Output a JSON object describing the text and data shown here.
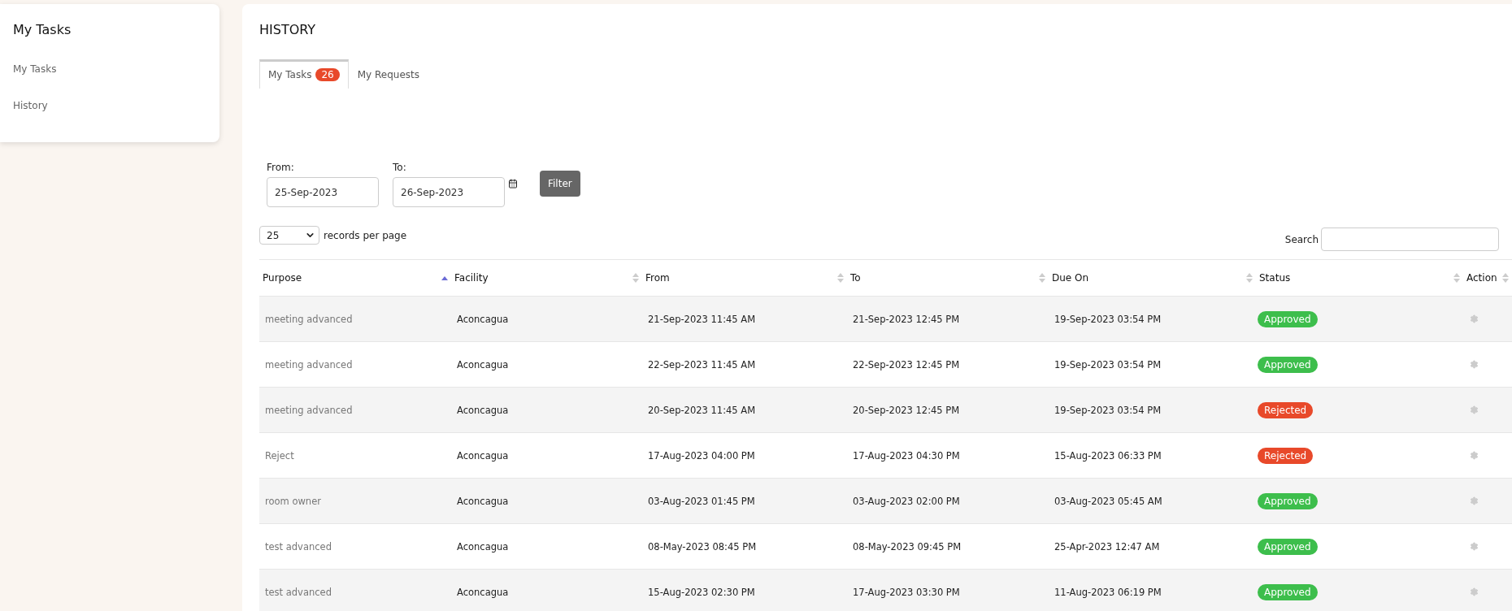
{
  "sidebar": {
    "title": "My Tasks",
    "items": [
      {
        "label": "My Tasks",
        "selected": false
      },
      {
        "label": "History",
        "selected": false
      }
    ]
  },
  "main": {
    "title": "HISTORY",
    "tabs": [
      {
        "label": "My Tasks",
        "badge": "26",
        "selected": true
      },
      {
        "label": "My Requests",
        "selected": false
      }
    ],
    "filter": {
      "from_label": "From:",
      "from_value": "25-Sep-2023",
      "to_label": "To:",
      "to_value": "26-Sep-2023",
      "button": "Filter"
    },
    "page_size": {
      "value": "25",
      "label": "records per page"
    },
    "search": {
      "label": "Search"
    },
    "table": {
      "columns": [
        {
          "label": "Purpose",
          "sorted": true
        },
        {
          "label": "Facility",
          "sorted": false
        },
        {
          "label": "From",
          "sorted": false
        },
        {
          "label": "To",
          "sorted": false
        },
        {
          "label": "Due On",
          "sorted": false
        },
        {
          "label": "Status",
          "sorted": false
        },
        {
          "label": "Action",
          "sorted": false
        }
      ],
      "rows": [
        {
          "purpose": "meeting advanced",
          "facility": "Aconcagua",
          "from": "21-Sep-2023 11:45 AM",
          "to": "21-Sep-2023 12:45 PM",
          "due_on": "19-Sep-2023 03:54 PM",
          "status": {
            "label": "Approved",
            "kind": "approved"
          }
        },
        {
          "purpose": "meeting advanced",
          "facility": "Aconcagua",
          "from": "22-Sep-2023 11:45 AM",
          "to": "22-Sep-2023 12:45 PM",
          "due_on": "19-Sep-2023 03:54 PM",
          "status": {
            "label": "Approved",
            "kind": "approved"
          }
        },
        {
          "purpose": "meeting advanced",
          "facility": "Aconcagua",
          "from": "20-Sep-2023 11:45 AM",
          "to": "20-Sep-2023 12:45 PM",
          "due_on": "19-Sep-2023 03:54 PM",
          "status": {
            "label": "Rejected",
            "kind": "rejected"
          }
        },
        {
          "purpose": "Reject",
          "facility": "Aconcagua",
          "from": "17-Aug-2023 04:00 PM",
          "to": "17-Aug-2023 04:30 PM",
          "due_on": "15-Aug-2023 06:33 PM",
          "status": {
            "label": "Rejected",
            "kind": "rejected"
          }
        },
        {
          "purpose": "room owner",
          "facility": "Aconcagua",
          "from": "03-Aug-2023 01:45 PM",
          "to": "03-Aug-2023 02:00 PM",
          "due_on": "03-Aug-2023 05:45 AM",
          "status": {
            "label": "Approved",
            "kind": "approved"
          }
        },
        {
          "purpose": "test advanced",
          "facility": "Aconcagua",
          "from": "08-May-2023 08:45 PM",
          "to": "08-May-2023 09:45 PM",
          "due_on": "25-Apr-2023 12:47 AM",
          "status": {
            "label": "Approved",
            "kind": "approved"
          }
        },
        {
          "purpose": "test advanced",
          "facility": "Aconcagua",
          "from": "15-Aug-2023 02:30 PM",
          "to": "17-Aug-2023 03:30 PM",
          "due_on": "11-Aug-2023 06:19 PM",
          "status": {
            "label": "Approved",
            "kind": "approved"
          }
        }
      ]
    }
  }
}
